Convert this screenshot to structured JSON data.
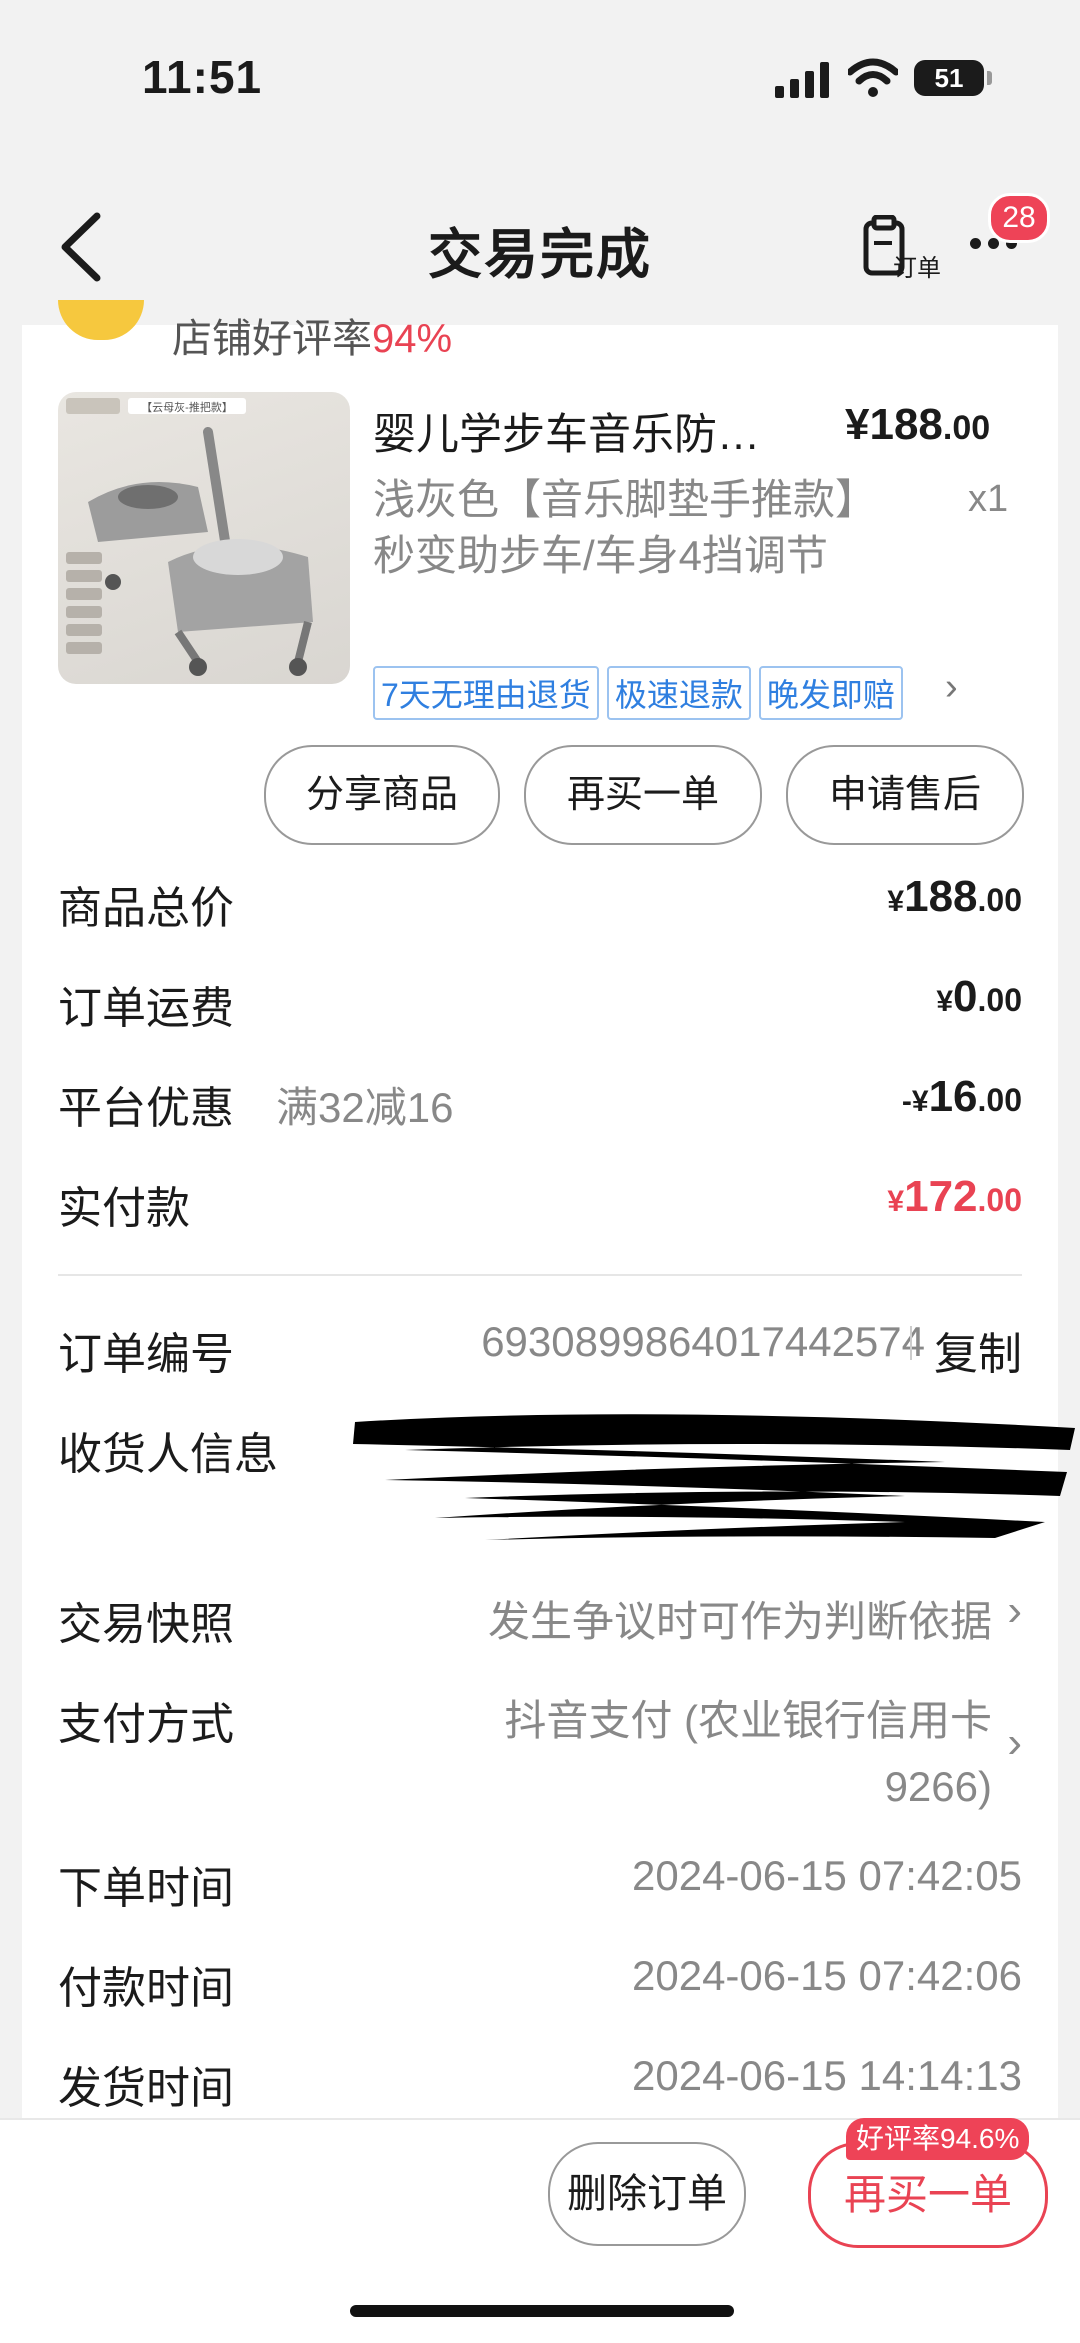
{
  "status_bar": {
    "time": "11:51",
    "battery": "51"
  },
  "nav": {
    "title": "交易完成",
    "order_label": "订单",
    "badge_count": "28"
  },
  "shop": {
    "rating_label": "店铺好评率",
    "rating_value": "94%"
  },
  "product": {
    "name": "婴儿学步车音乐防…",
    "price_main": "¥188",
    "price_decimal": ".00",
    "spec": "浅灰色【音乐脚垫手推款】秒变助步车/车身4挡调节",
    "qty": "x1",
    "image_caption": "【云母灰-推把款】",
    "tags": [
      "7天无理由退货",
      "极速退款",
      "晚发即赔"
    ]
  },
  "actions": {
    "share": "分享商品",
    "rebuy": "再买一单",
    "after_sale": "申请售后"
  },
  "price_rows": [
    {
      "label": "商品总价",
      "currency": "¥",
      "main": "188",
      "decimal": ".00"
    },
    {
      "label": "订单运费",
      "currency": "¥",
      "main": "0",
      "decimal": ".00"
    },
    {
      "label": "平台优惠",
      "note": "满32减16",
      "currency": "-¥",
      "main": "16",
      "decimal": ".00"
    },
    {
      "label": "实付款",
      "currency": "¥",
      "main": "172",
      "decimal": ".00"
    }
  ],
  "info": {
    "order_no_label": "订单编号",
    "order_no": "6930899864017442574",
    "copy": "复制",
    "receiver_label": "收货人信息",
    "snapshot_label": "交易快照",
    "snapshot_value": "发生争议时可作为判断依据",
    "pay_label": "支付方式",
    "pay_line1": "抖音支付 (农业银行信用卡",
    "pay_line2": "9266)",
    "order_time_label": "下单时间",
    "order_time": "2024-06-15 07:42:05",
    "pay_time_label": "付款时间",
    "pay_time": "2024-06-15 07:42:06",
    "ship_time_label": "发货时间",
    "ship_time": "2024-06-15 14:14:13"
  },
  "bottom": {
    "delete": "删除订单",
    "rebuy": "再买一单",
    "rebuy_badge": "好评率94.6%"
  }
}
